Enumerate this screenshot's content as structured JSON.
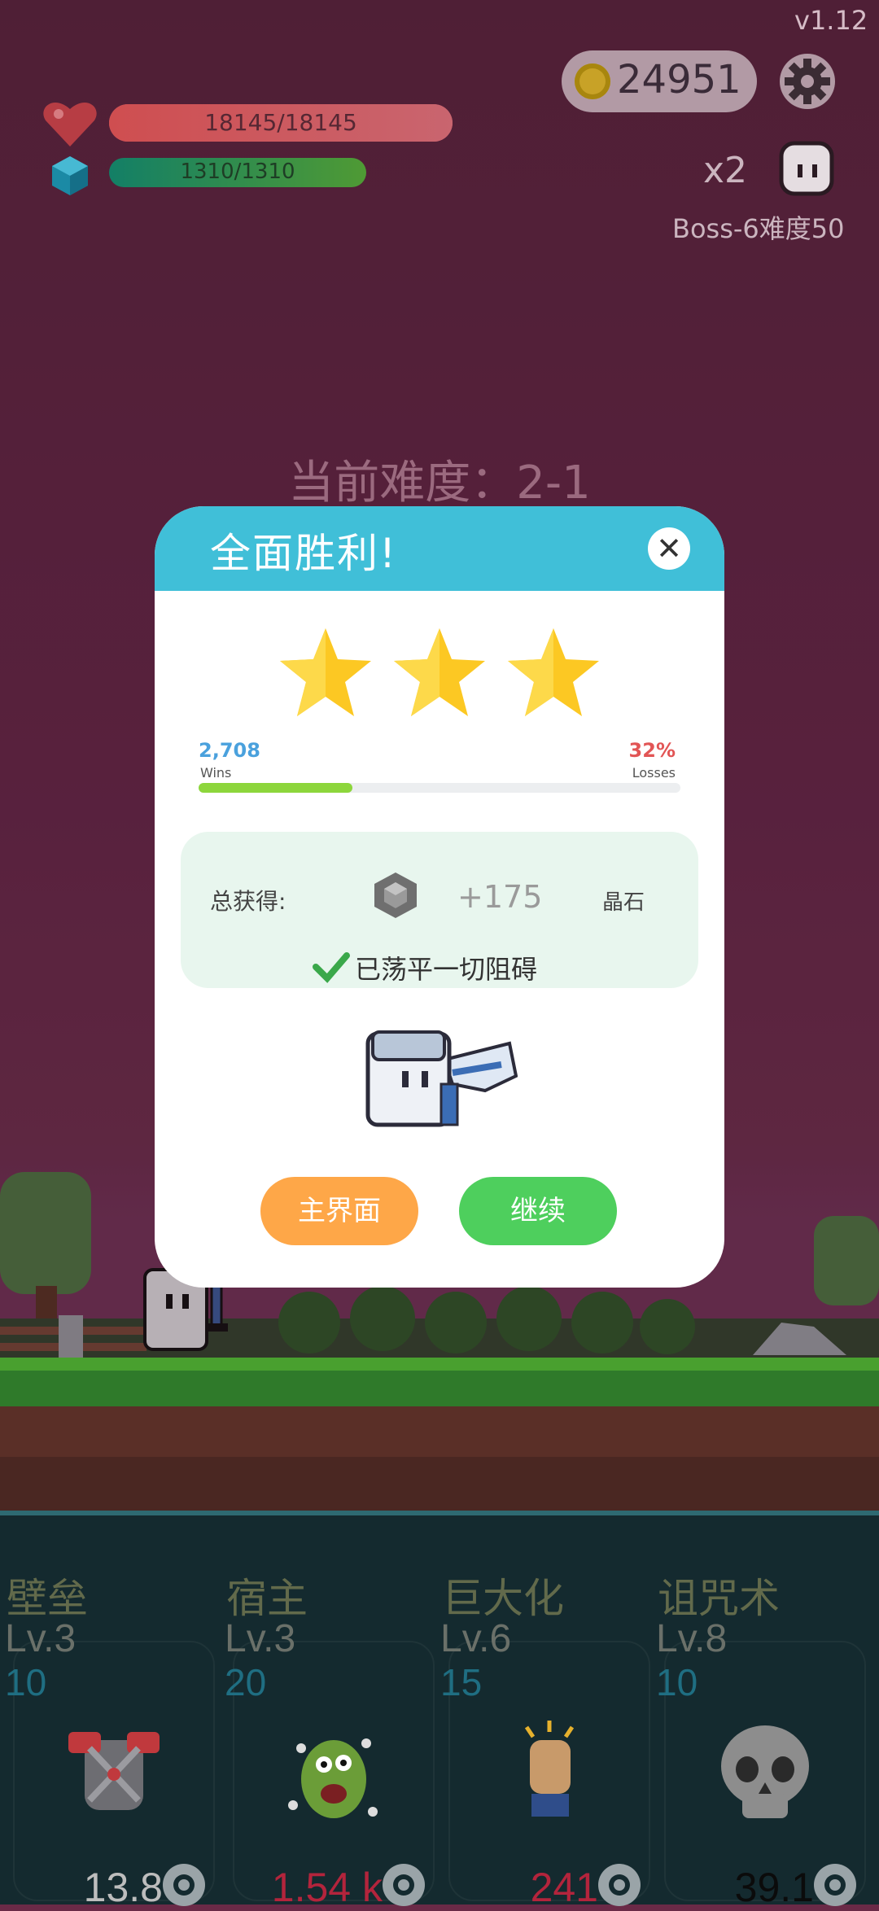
{
  "hud": {
    "version": "v1.12",
    "coins": "24951",
    "hp": "18145/18145",
    "mp": "1310/1310",
    "multiplier": "x2",
    "boss_label": "Boss-6难度50"
  },
  "difficulty_label": "当前难度：2-1",
  "modal": {
    "title": "全面胜利!",
    "close": "✕",
    "stars": 3,
    "wins_value": "2,708",
    "wins_label": "Wins",
    "losses_value": "32%",
    "losses_label": "Losses",
    "progress_fraction": 0.32,
    "reward_label": "总获得:",
    "reward_amount": "+175",
    "reward_unit": "晶石",
    "cleared_text": "已荡平一切阻碍",
    "btn_main": "主界面",
    "btn_continue": "继续"
  },
  "skills": [
    {
      "name": "壁垒",
      "level": "Lv.3",
      "cost": "10",
      "value": "13.8",
      "value_color": "#bdbdbd",
      "icon": "armor-icon"
    },
    {
      "name": "宿主",
      "level": "Lv.3",
      "cost": "20",
      "value": "1.54 k",
      "value_color": "#b3243c",
      "icon": "monster-icon"
    },
    {
      "name": "巨大化",
      "level": "Lv.6",
      "cost": "15",
      "value": "241",
      "value_color": "#b3243c",
      "icon": "fist-icon"
    },
    {
      "name": "诅咒术",
      "level": "Lv.8",
      "cost": "10",
      "value": "39.1",
      "value_color": "#0b0b0b",
      "icon": "skull-icon"
    }
  ],
  "colors": {
    "modal_header": "#40bfd8",
    "btn_main": "#fea748",
    "btn_continue": "#4ecf5d",
    "progress": "#8dd63c"
  }
}
